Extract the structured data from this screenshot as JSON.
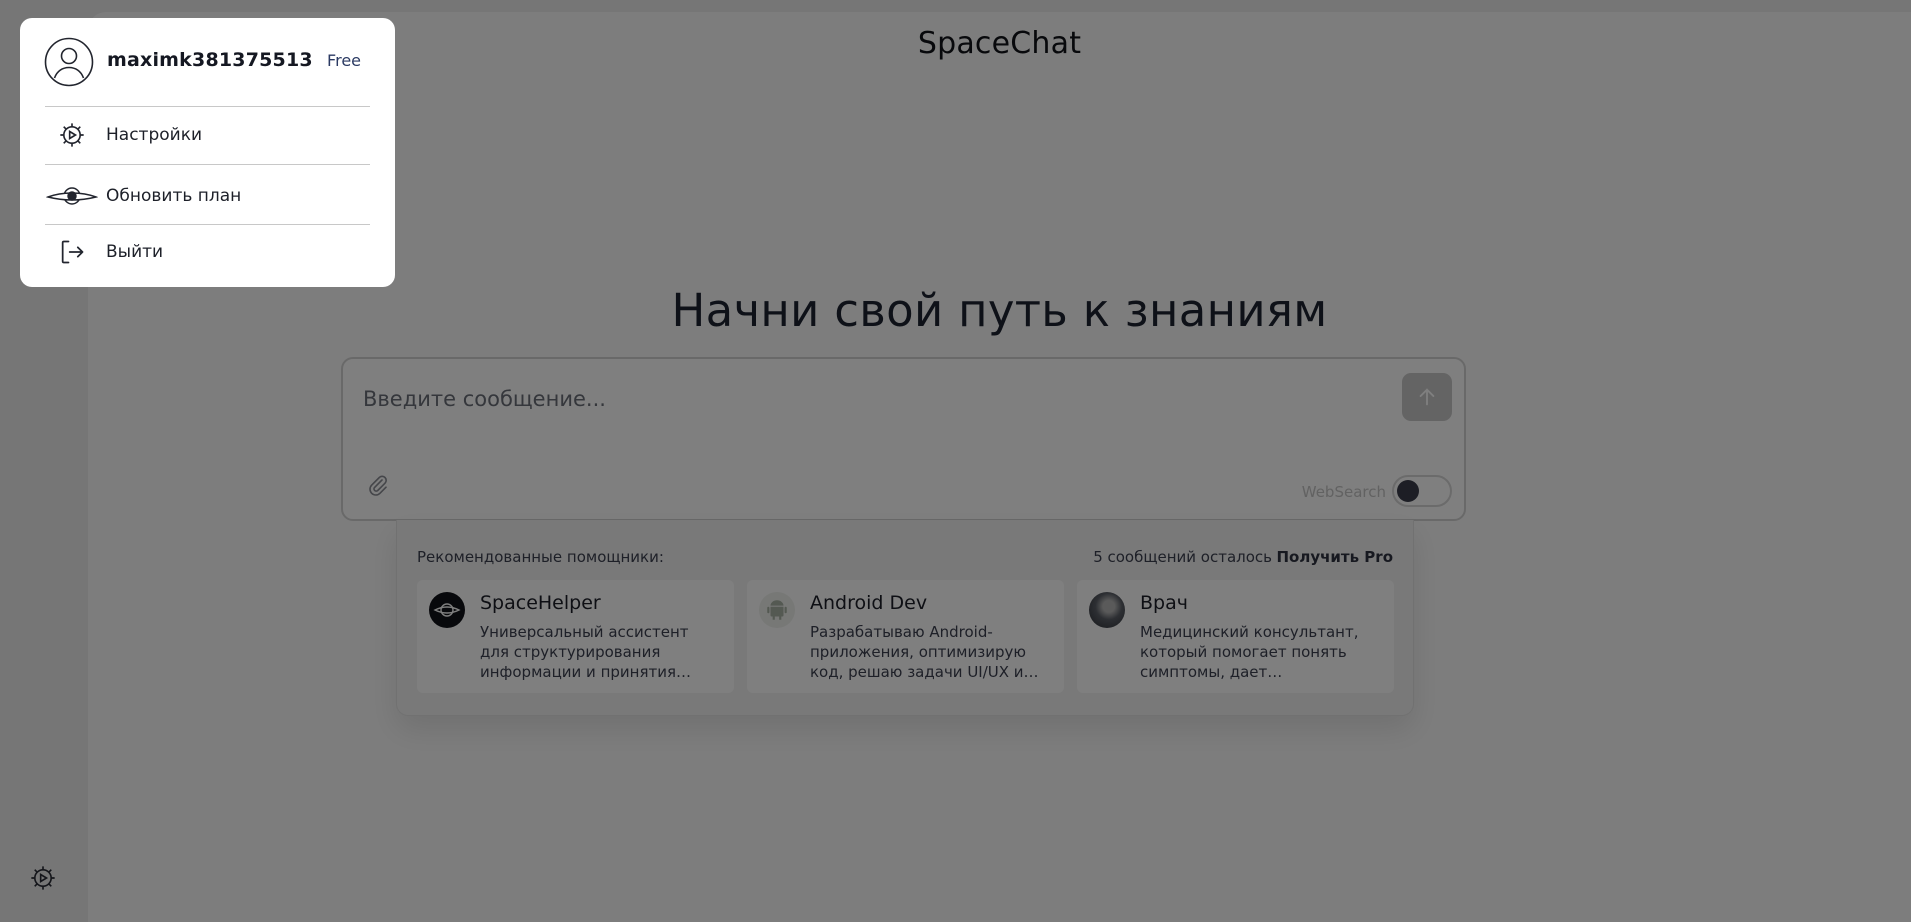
{
  "app": {
    "title": "SpaceChat"
  },
  "hero": {
    "title": "Начни свой путь к знаниям"
  },
  "composer": {
    "placeholder": "Введите сообщение...",
    "websearch_label": "WebSearch",
    "websearch_enabled": false
  },
  "suggestions": {
    "heading": "Рекомендованные помощники:",
    "messages_left": "5 сообщений осталось",
    "get_pro": "Получить Pro",
    "assistants": [
      {
        "name": "SpaceHelper",
        "description": "Универсальный ассистент для структурирования информации и принятия…",
        "icon": "spacehelper-logo-icon"
      },
      {
        "name": "Android Dev",
        "description": "Разрабатываю Android-приложения, оптимизирую код, решаю задачи UI/UX и…",
        "icon": "android-icon"
      },
      {
        "name": "Врач",
        "description": "Медицинский консультант, который помогает понять симптомы, дает…",
        "icon": "doctor-avatar"
      }
    ]
  },
  "profile_menu": {
    "username": "maximk381375513",
    "plan": "Free",
    "items": [
      {
        "label": "Настройки",
        "icon": "gear-icon"
      },
      {
        "label": "Обновить план",
        "icon": "planet-icon"
      },
      {
        "label": "Выйти",
        "icon": "logout-icon"
      }
    ]
  },
  "colors": {
    "overlay": "rgba(0,0,0,0.5)",
    "plan_badge": "#2b3a63",
    "send_button": "#c9c9c9"
  }
}
